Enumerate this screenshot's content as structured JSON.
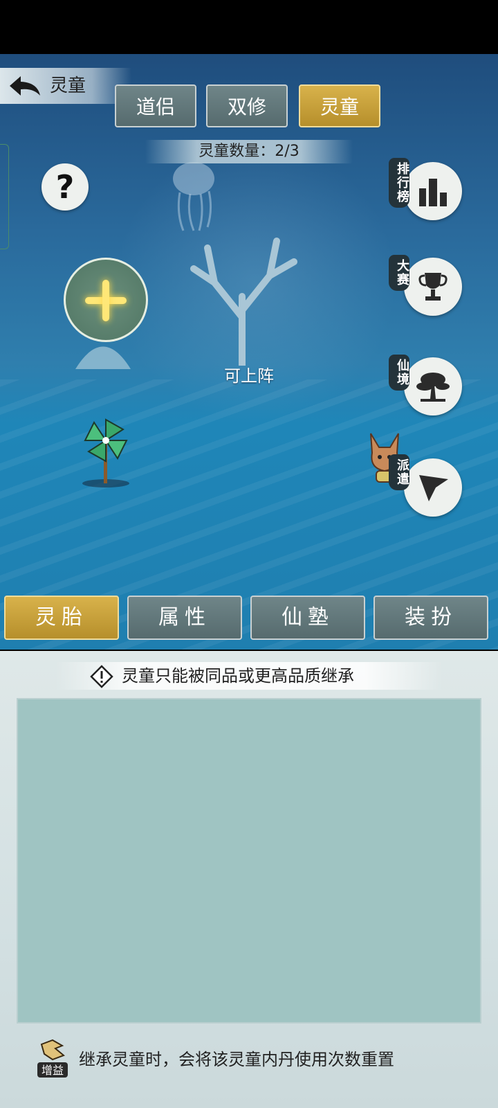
{
  "header": {
    "back_title": "灵童"
  },
  "top_tabs": [
    {
      "label": "道侣",
      "active": false
    },
    {
      "label": "双修",
      "active": false
    },
    {
      "label": "灵童",
      "active": true
    }
  ],
  "count_label": "灵童数量：2/3",
  "scene": {
    "slot_status": "可上阵"
  },
  "side_buttons": [
    {
      "label": "排行榜",
      "icon": "ranking-icon"
    },
    {
      "label": "大赛",
      "icon": "trophy-icon"
    },
    {
      "label": "仙境",
      "icon": "tree-icon"
    },
    {
      "label": "派遣",
      "icon": "flag-icon"
    }
  ],
  "bottom_tabs": [
    {
      "label": "灵胎",
      "active": true
    },
    {
      "label": "属性",
      "active": false
    },
    {
      "label": "仙塾",
      "active": false
    },
    {
      "label": "装扮",
      "active": false
    }
  ],
  "panel": {
    "notice": "灵童只能被同品或更高品质继承",
    "footer_note": "继承灵童时，会将该灵童内丹使用次数重置",
    "boost_badge": "增益"
  },
  "colors": {
    "active_tab": "#c9a23c",
    "inactive_tab": "#627a7d",
    "panel_bg": "#d8e3e4",
    "content_area": "#9fc4c2"
  }
}
